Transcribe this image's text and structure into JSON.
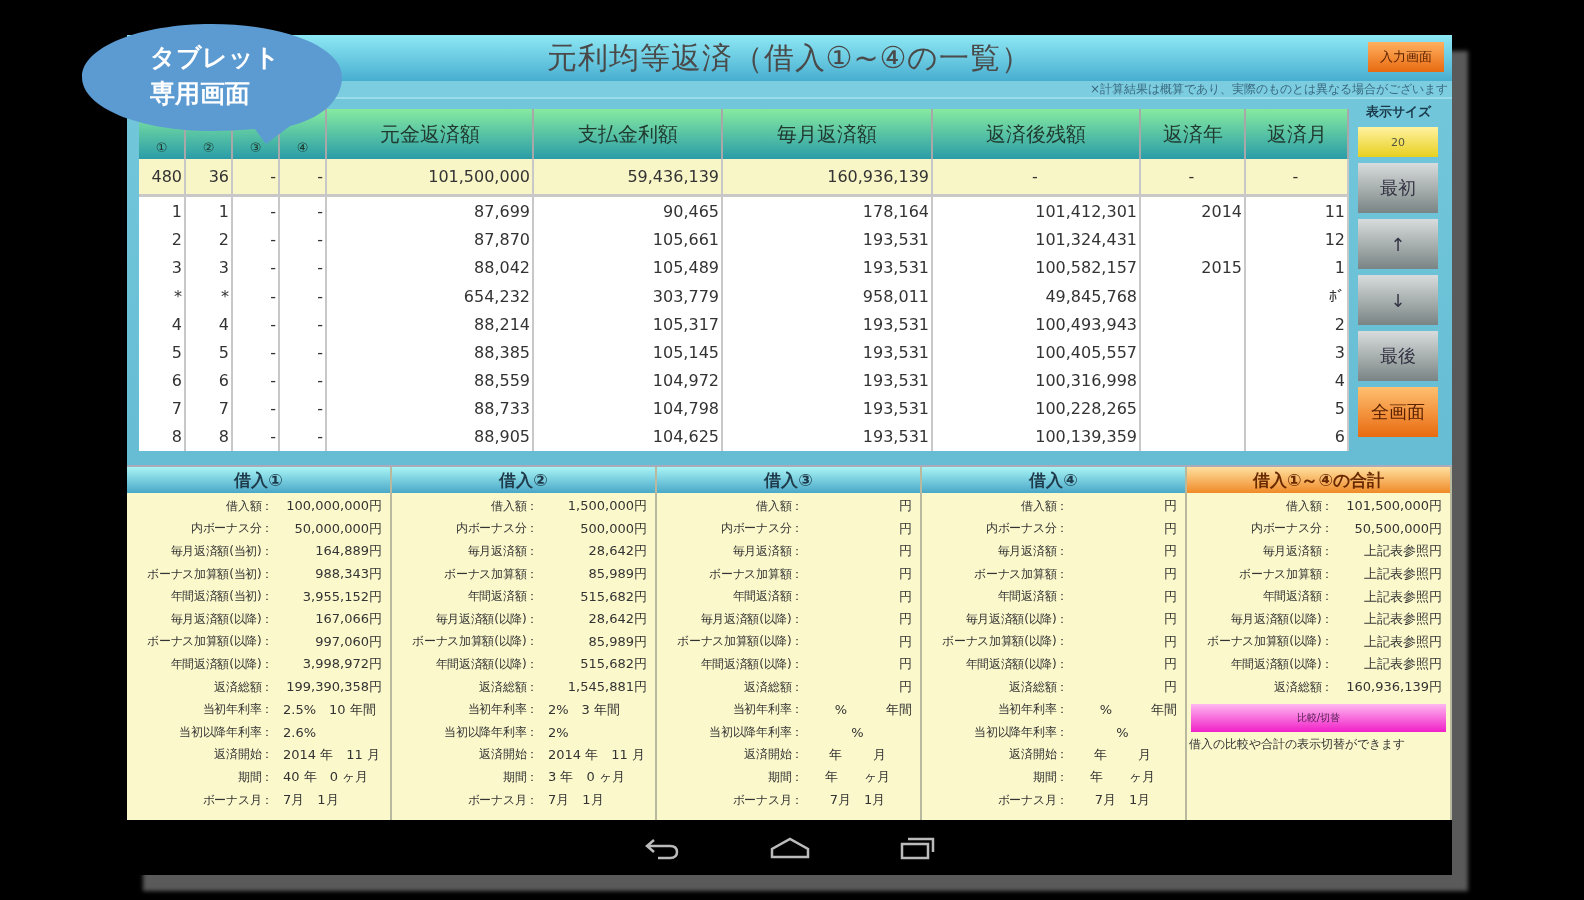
{
  "callout": {
    "lines": [
      "タブレット",
      "専用画面"
    ]
  },
  "title": "元利均等返済（借入①~④の一覧）",
  "input_button": "入力画面",
  "note": "×計算結果は概算であり、実際のものとは異なる場合がございます",
  "table": {
    "columns": [
      "①",
      "②",
      "③",
      "④",
      "元金返済額",
      "支払金利額",
      "毎月返済額",
      "返済後残額",
      "返済年",
      "返済月"
    ],
    "summary": [
      "480",
      "36",
      "-",
      "-",
      "101,500,000",
      "59,436,139",
      "160,936,139",
      "-",
      "-",
      "-"
    ],
    "rows": [
      [
        "1",
        "1",
        "-",
        "-",
        "87,699",
        "90,465",
        "178,164",
        "101,412,301",
        "2014",
        "11"
      ],
      [
        "2",
        "2",
        "-",
        "-",
        "87,870",
        "105,661",
        "193,531",
        "101,324,431",
        "",
        "12"
      ],
      [
        "3",
        "3",
        "-",
        "-",
        "88,042",
        "105,489",
        "193,531",
        "100,582,157",
        "2015",
        "1"
      ],
      [
        "*",
        "*",
        "-",
        "-",
        "654,232",
        "303,779",
        "958,011",
        "49,845,768",
        "",
        "ﾎﾞ"
      ],
      [
        "4",
        "4",
        "-",
        "-",
        "88,214",
        "105,317",
        "193,531",
        "100,493,943",
        "",
        "2"
      ],
      [
        "5",
        "5",
        "-",
        "-",
        "88,385",
        "105,145",
        "193,531",
        "100,405,557",
        "",
        "3"
      ],
      [
        "6",
        "6",
        "-",
        "-",
        "88,559",
        "104,972",
        "193,531",
        "100,316,998",
        "",
        "4"
      ],
      [
        "7",
        "7",
        "-",
        "-",
        "88,733",
        "104,798",
        "193,531",
        "100,228,265",
        "",
        "5"
      ],
      [
        "8",
        "8",
        "-",
        "-",
        "88,905",
        "104,625",
        "193,531",
        "100,139,359",
        "",
        "6"
      ]
    ]
  },
  "side": {
    "size_label": "表示サイズ",
    "size_value": "20",
    "buttons": [
      {
        "label": "最初",
        "kind": "gray"
      },
      {
        "label": "↑",
        "kind": "gray"
      },
      {
        "label": "↓",
        "kind": "gray"
      },
      {
        "label": "最後",
        "kind": "gray"
      },
      {
        "label": "全画面",
        "kind": "orange"
      }
    ]
  },
  "panels": [
    {
      "title": "借入①",
      "kind": "loan",
      "rows": [
        {
          "label": "借入額：",
          "value": "100,000,000円",
          "kind": "amount"
        },
        {
          "label": "内ボーナス分：",
          "value": "50,000,000円",
          "kind": "amount"
        },
        {
          "label": "毎月返済額(当初)：",
          "value": "164,889円",
          "kind": "amount"
        },
        {
          "label": "ボーナス加算額(当初)：",
          "value": "988,343円",
          "kind": "amount"
        },
        {
          "label": "年間返済額(当初)：",
          "value": "3,955,152円",
          "kind": "amount"
        },
        {
          "label": "毎月返済額(以降)：",
          "value": "167,066円",
          "kind": "amount"
        },
        {
          "label": "ボーナス加算額(以降)：",
          "value": "997,060円",
          "kind": "amount"
        },
        {
          "label": "年間返済額(以降)：",
          "value": "3,998,972円",
          "kind": "amount"
        },
        {
          "label": "返済総額：",
          "value": "199,390,358円",
          "kind": "amount"
        },
        {
          "label": "当初年利率：",
          "value": "2.5%　10 年間",
          "kind": "text"
        },
        {
          "label": "当初以降年利率：",
          "value": "2.6%",
          "kind": "text"
        },
        {
          "label": "返済開始：",
          "value": "2014 年　11 月",
          "kind": "text"
        },
        {
          "label": "期間：",
          "value": "40 年　0 ヶ月",
          "kind": "text"
        },
        {
          "label": "ボーナス月：",
          "value": "7月　1月",
          "kind": "text"
        }
      ]
    },
    {
      "title": "借入②",
      "kind": "loan",
      "rows": [
        {
          "label": "借入額：",
          "value": "1,500,000円",
          "kind": "amount"
        },
        {
          "label": "内ボーナス分：",
          "value": "500,000円",
          "kind": "amount"
        },
        {
          "label": "毎月返済額：",
          "value": "28,642円",
          "kind": "amount"
        },
        {
          "label": "ボーナス加算額：",
          "value": "85,989円",
          "kind": "amount"
        },
        {
          "label": "年間返済額：",
          "value": "515,682円",
          "kind": "amount"
        },
        {
          "label": "毎月返済額(以降)：",
          "value": "28,642円",
          "kind": "amount"
        },
        {
          "label": "ボーナス加算額(以降)：",
          "value": "85,989円",
          "kind": "amount"
        },
        {
          "label": "年間返済額(以降)：",
          "value": "515,682円",
          "kind": "amount"
        },
        {
          "label": "返済総額：",
          "value": "1,545,881円",
          "kind": "amount"
        },
        {
          "label": "当初年利率：",
          "value": "2%　3 年間",
          "kind": "text"
        },
        {
          "label": "当初以降年利率：",
          "value": "2%",
          "kind": "text"
        },
        {
          "label": "返済開始：",
          "value": "2014 年　11 月",
          "kind": "text"
        },
        {
          "label": "期間：",
          "value": "3 年　0 ヶ月",
          "kind": "text"
        },
        {
          "label": "ボーナス月：",
          "value": "7月　1月",
          "kind": "text"
        }
      ]
    },
    {
      "title": "借入③",
      "kind": "loan",
      "rows": [
        {
          "label": "借入額：",
          "value": "円",
          "kind": "amount"
        },
        {
          "label": "内ボーナス分：",
          "value": "円",
          "kind": "amount"
        },
        {
          "label": "毎月返済額：",
          "value": "円",
          "kind": "amount"
        },
        {
          "label": "ボーナス加算額：",
          "value": "円",
          "kind": "amount"
        },
        {
          "label": "年間返済額：",
          "value": "円",
          "kind": "amount"
        },
        {
          "label": "毎月返済額(以降)：",
          "value": "円",
          "kind": "amount"
        },
        {
          "label": "ボーナス加算額(以降)：",
          "value": "円",
          "kind": "amount"
        },
        {
          "label": "年間返済額(以降)：",
          "value": "円",
          "kind": "amount"
        },
        {
          "label": "返済総額：",
          "value": "円",
          "kind": "amount"
        },
        {
          "label": "当初年利率：",
          "value": "%　　　年間",
          "kind": "amount"
        },
        {
          "label": "当初以降年利率：",
          "value": "%",
          "kind": "center"
        },
        {
          "label": "返済開始：",
          "value": "年　　 月",
          "kind": "center"
        },
        {
          "label": "期間：",
          "value": "年　　ヶ月",
          "kind": "center"
        },
        {
          "label": "ボーナス月：",
          "value": "7月　1月",
          "kind": "center"
        }
      ]
    },
    {
      "title": "借入④",
      "kind": "loan",
      "rows": [
        {
          "label": "借入額：",
          "value": "円",
          "kind": "amount"
        },
        {
          "label": "内ボーナス分：",
          "value": "円",
          "kind": "amount"
        },
        {
          "label": "毎月返済額：",
          "value": "円",
          "kind": "amount"
        },
        {
          "label": "ボーナス加算額：",
          "value": "円",
          "kind": "amount"
        },
        {
          "label": "年間返済額：",
          "value": "円",
          "kind": "amount"
        },
        {
          "label": "毎月返済額(以降)：",
          "value": "円",
          "kind": "amount"
        },
        {
          "label": "ボーナス加算額(以降)：",
          "value": "円",
          "kind": "amount"
        },
        {
          "label": "年間返済額(以降)：",
          "value": "円",
          "kind": "amount"
        },
        {
          "label": "返済総額：",
          "value": "円",
          "kind": "amount"
        },
        {
          "label": "当初年利率：",
          "value": "%　　　年間",
          "kind": "amount"
        },
        {
          "label": "当初以降年利率：",
          "value": "%",
          "kind": "center"
        },
        {
          "label": "返済開始：",
          "value": "年　　 月",
          "kind": "center"
        },
        {
          "label": "期間：",
          "value": "年　　ヶ月",
          "kind": "center"
        },
        {
          "label": "ボーナス月：",
          "value": "7月　1月",
          "kind": "center"
        }
      ]
    },
    {
      "title": "借入①～④の合計",
      "kind": "total",
      "rows": [
        {
          "label": "借入額：",
          "value": "101,500,000円",
          "kind": "amount"
        },
        {
          "label": "内ボーナス分：",
          "value": "50,500,000円",
          "kind": "amount"
        },
        {
          "label": "毎月返済額：",
          "value": "上記表参照円",
          "kind": "amount"
        },
        {
          "label": "ボーナス加算額：",
          "value": "上記表参照円",
          "kind": "amount"
        },
        {
          "label": "年間返済額：",
          "value": "上記表参照円",
          "kind": "amount"
        },
        {
          "label": "毎月返済額(以降)：",
          "value": "上記表参照円",
          "kind": "amount"
        },
        {
          "label": "ボーナス加算額(以降)：",
          "value": "上記表参照円",
          "kind": "amount"
        },
        {
          "label": "年間返済額(以降)：",
          "value": "上記表参照円",
          "kind": "amount"
        },
        {
          "label": "返済総額：",
          "value": "160,936,139円",
          "kind": "amount"
        }
      ],
      "button": "比較/切替",
      "hint": "借入の比較や合計の表示切替ができます"
    }
  ]
}
